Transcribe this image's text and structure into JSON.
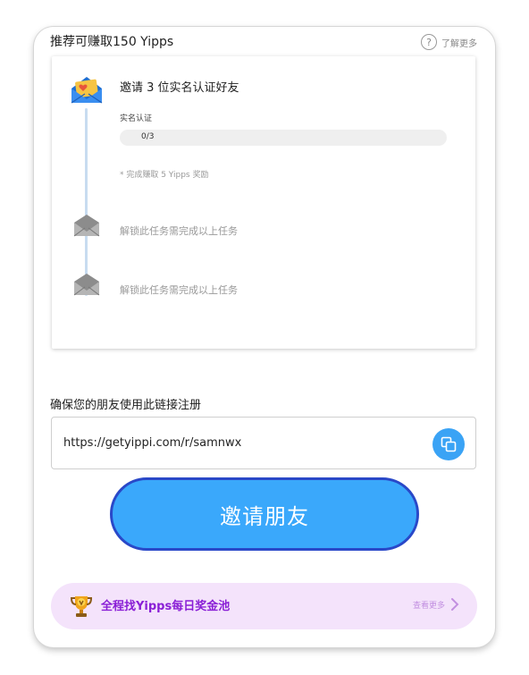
{
  "header": {
    "title": "推荐可赚取150 Yipps",
    "help_glyph": "?",
    "learn_more": "了解更多"
  },
  "tasks": {
    "active": {
      "title": "邀请 3 位实名认证好友",
      "sub_label": "实名认证",
      "progress_text": "0/3",
      "progress_fraction": 0,
      "reward_note": "* 完成赚取 5 Yipps 奖励"
    },
    "locked": [
      {
        "text": "解锁此任务需完成以上任务"
      },
      {
        "text": "解锁此任务需完成以上任务"
      }
    ]
  },
  "link": {
    "label": "确保您的朋友使用此链接注册",
    "url": "https://getyippi.com/r/samnwx"
  },
  "invite_button": {
    "label": "邀请朋友"
  },
  "pool_banner": {
    "title": "全程找Yipps每日奖金池",
    "more": "查看更多",
    "icon": "trophy-icon"
  },
  "colors": {
    "accent_blue": "#3aa8fb",
    "button_border": "#2948c8",
    "banner_bg": "#f4e3fb",
    "banner_text": "#8a1fd6"
  }
}
